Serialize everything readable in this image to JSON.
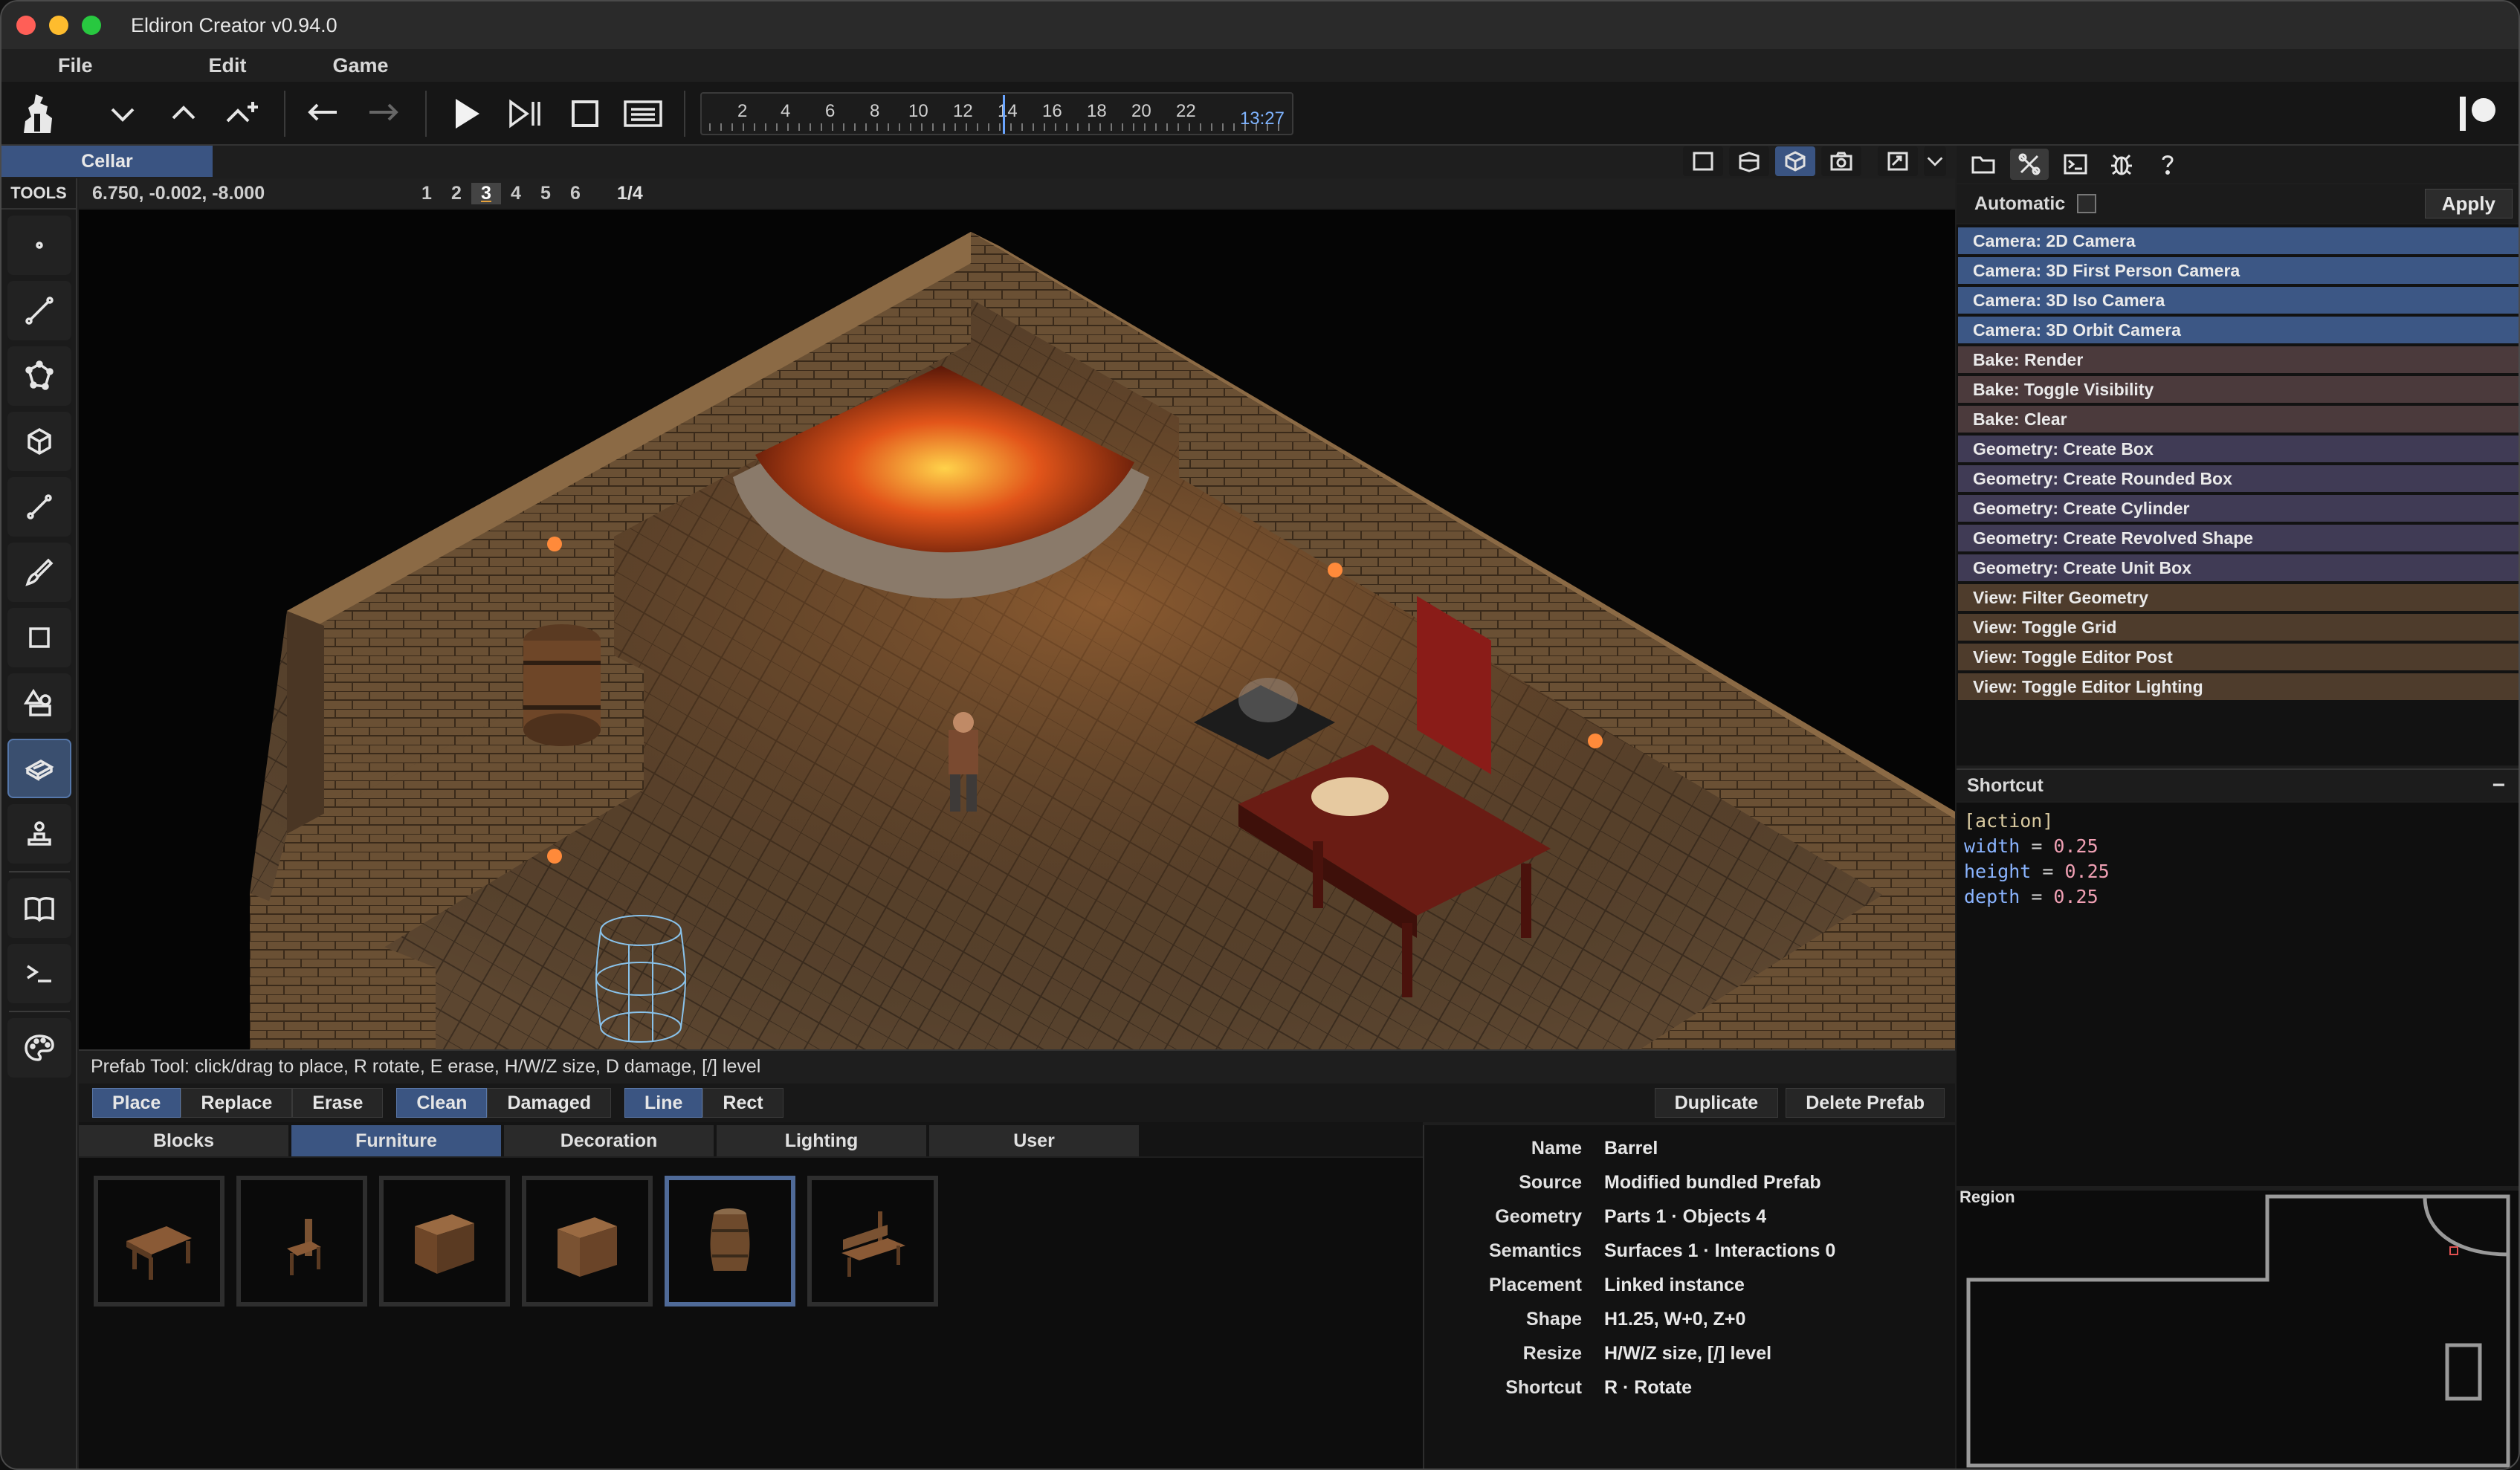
{
  "window": {
    "title": "Eldiron Creator v0.94.0"
  },
  "menu": [
    "File",
    "Edit",
    "Game"
  ],
  "timeline": {
    "ticks": [
      "2",
      "4",
      "6",
      "8",
      "10",
      "12",
      "14",
      "16",
      "18",
      "20",
      "22"
    ],
    "time": "13:27"
  },
  "region_tab": "Cellar",
  "tools_label": "TOOLS",
  "view": {
    "coords": "6.750, -0.002, -8.000",
    "levels": [
      "1",
      "2",
      "3",
      "4",
      "5",
      "6"
    ],
    "active_level": "3",
    "page": "1/4"
  },
  "status": "Prefab Tool: click/drag to place, R rotate, E erase, H/W/Z size, D damage, [/] level",
  "modes": {
    "place": "Place",
    "replace": "Replace",
    "erase": "Erase",
    "clean": "Clean",
    "damaged": "Damaged",
    "line": "Line",
    "rect": "Rect",
    "duplicate": "Duplicate",
    "delete": "Delete Prefab"
  },
  "categories": [
    "Blocks",
    "Furniture",
    "Decoration",
    "Lighting",
    "User"
  ],
  "active_category": "Furniture",
  "properties": [
    {
      "key": "Name",
      "value": "Barrel"
    },
    {
      "key": "Source",
      "value": "Modified bundled Prefab"
    },
    {
      "key": "Geometry",
      "value": "Parts 1 · Objects 4"
    },
    {
      "key": "Semantics",
      "value": "Surfaces 1 · Interactions 0"
    },
    {
      "key": "Placement",
      "value": "Linked instance"
    },
    {
      "key": "Shape",
      "value": "H1.25, W+0, Z+0"
    },
    {
      "key": "Resize",
      "value": "H/W/Z size, [/] level"
    },
    {
      "key": "Shortcut",
      "value": "R · Rotate"
    }
  ],
  "right": {
    "automatic_label": "Automatic",
    "apply_label": "Apply",
    "actions": [
      {
        "label": "Camera: 2D Camera",
        "color": "#3c5785"
      },
      {
        "label": "Camera: 3D First Person Camera",
        "color": "#3c5785"
      },
      {
        "label": "Camera: 3D Iso Camera",
        "color": "#3c5785"
      },
      {
        "label": "Camera: 3D Orbit Camera",
        "color": "#3c5785"
      },
      {
        "label": "Bake: Render",
        "color": "#4b3a3c"
      },
      {
        "label": "Bake: Toggle Visibility",
        "color": "#4b3a3c"
      },
      {
        "label": "Bake: Clear",
        "color": "#4b3a3c"
      },
      {
        "label": "Geometry: Create Box",
        "color": "#403b55"
      },
      {
        "label": "Geometry: Create Rounded Box",
        "color": "#403b55"
      },
      {
        "label": "Geometry: Create Cylinder",
        "color": "#403b55"
      },
      {
        "label": "Geometry: Create Revolved Shape",
        "color": "#403b55"
      },
      {
        "label": "Geometry: Create Unit Box",
        "color": "#403b55"
      },
      {
        "label": "View: Filter Geometry",
        "color": "#4e3c2c"
      },
      {
        "label": "View: Toggle Grid",
        "color": "#4e3c2c"
      },
      {
        "label": "View: Toggle Editor Post",
        "color": "#4e3c2c"
      },
      {
        "label": "View: Toggle Editor Lighting",
        "color": "#4e3c2c"
      }
    ],
    "shortcut_title": "Shortcut",
    "shortcut_collapse": "−",
    "code": {
      "section": "[action]",
      "lines": [
        {
          "key": "width",
          "value": "0.25"
        },
        {
          "key": "height",
          "value": "0.25"
        },
        {
          "key": "depth",
          "value": "0.25"
        }
      ]
    },
    "region_title": "Region"
  }
}
